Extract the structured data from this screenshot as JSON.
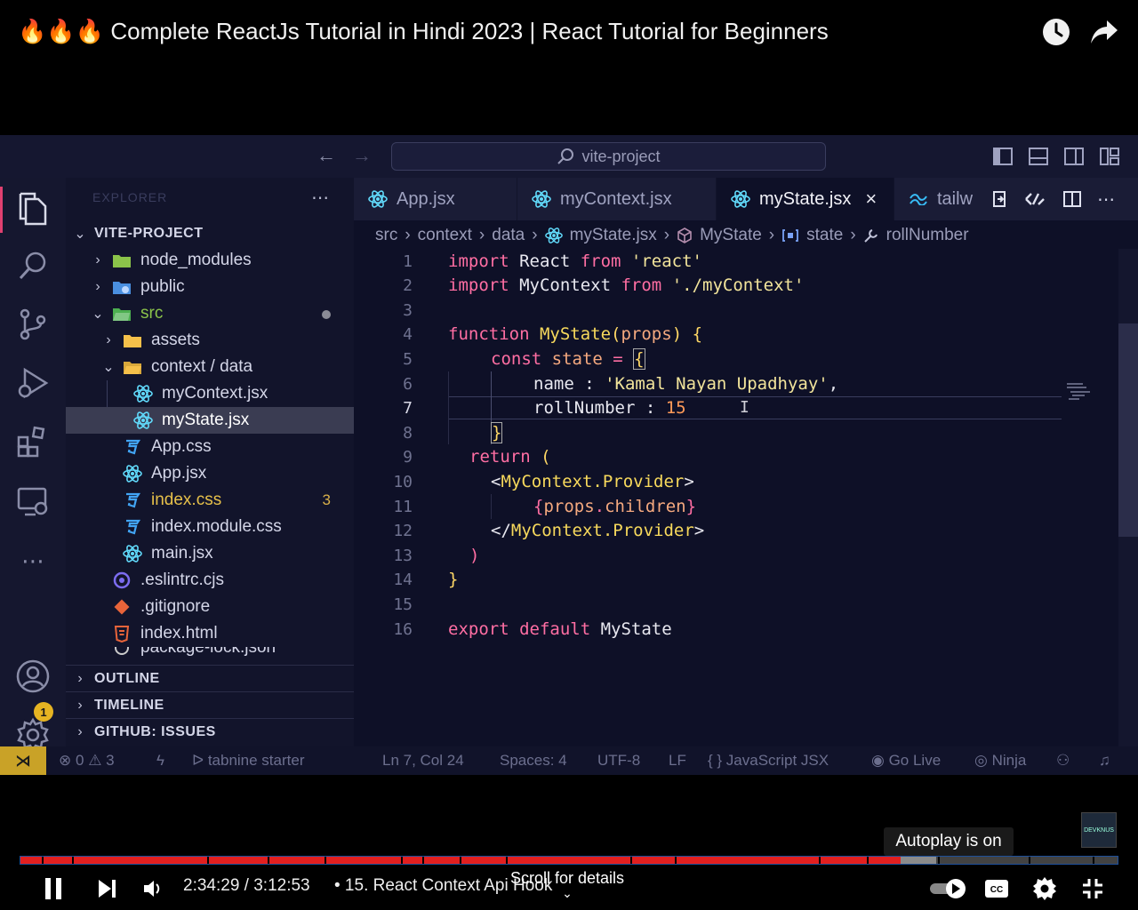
{
  "video": {
    "title": "🔥🔥🔥 Complete ReactJs Tutorial in Hindi 2023 | React Tutorial for Beginners",
    "watch_later_icon": "clock-icon",
    "share_icon": "share-icon"
  },
  "vscode": {
    "search_text": "vite-project",
    "explorer_header": "EXPLORER",
    "sidebar": {
      "project": "VITE-PROJECT",
      "items": [
        {
          "label": "node_modules"
        },
        {
          "label": "public"
        },
        {
          "label": "src"
        },
        {
          "label": "assets"
        },
        {
          "label": "context / data"
        },
        {
          "label": "myContext.jsx"
        },
        {
          "label": "myState.jsx"
        },
        {
          "label": "App.css"
        },
        {
          "label": "App.jsx"
        },
        {
          "label": "index.css",
          "count": "3"
        },
        {
          "label": "index.module.css"
        },
        {
          "label": "main.jsx"
        },
        {
          "label": ".eslintrc.cjs"
        },
        {
          "label": ".gitignore"
        },
        {
          "label": "index.html"
        },
        {
          "label": "package-lock.json"
        }
      ],
      "sections": [
        "OUTLINE",
        "TIMELINE",
        "GITHUB: ISSUES"
      ]
    },
    "account_badge": "1",
    "tabs": [
      {
        "label": "App.jsx"
      },
      {
        "label": "myContext.jsx"
      },
      {
        "label": "myState.jsx",
        "close": "×"
      },
      {
        "label": "tailw"
      }
    ],
    "breadcrumb": [
      "src",
      "context",
      "data",
      "myState.jsx",
      "MyState",
      "state",
      "rollNumber"
    ],
    "line_numbers": [
      "1",
      "2",
      "3",
      "4",
      "5",
      "6",
      "7",
      "8",
      "9",
      "10",
      "11",
      "12",
      "13",
      "14",
      "15",
      "16"
    ],
    "code": {
      "l1_a": "import",
      "l1_b": " React ",
      "l1_c": "from",
      "l1_d": " 'react'",
      "l2_a": "import",
      "l2_b": " MyContext ",
      "l2_c": "from",
      "l2_d": " './myContext'",
      "l4_a": "function",
      "l4_b": " MyState",
      "l4_c": "(",
      "l4_d": "props",
      "l4_e": ") {",
      "l5_a": "const",
      "l5_b": " state",
      "l5_c": " = ",
      "l5_d": "{",
      "l6_a": "name",
      "l6_b": " : ",
      "l6_c": "'Kamal Nayan Upadhyay'",
      "l6_d": ",",
      "l7_a": "rollNumber",
      "l7_b": " : ",
      "l7_c": "15",
      "l8_a": "}",
      "l9_a": "return",
      "l9_b": " (",
      "l10_a": "<",
      "l10_b": "MyContext.Provider",
      "l10_c": ">",
      "l11_a": "{",
      "l11_b": "props",
      "l11_c": ".",
      "l11_d": "children",
      "l11_e": "}",
      "l12_a": "</",
      "l12_b": "MyContext.Provider",
      "l12_c": ">",
      "l13_a": ")",
      "l14_a": "}",
      "l16_a": "export",
      "l16_b": " default",
      "l16_c": " MyState"
    },
    "status": {
      "errors": "0",
      "warnings": "3",
      "tabnine": "tabnine starter",
      "position": "Ln 7, Col 24",
      "spaces": "Spaces: 4",
      "encoding": "UTF-8",
      "eol": "LF",
      "language": "{ } JavaScript JSX",
      "golive": "Go Live",
      "ninja": "Ninja"
    }
  },
  "player": {
    "autoplay_tip": "Autoplay is on",
    "channel_logo": "DEVKNUS",
    "time": "2:34:29 / 3:12:53",
    "chapter": "• 15. React Context Api Hook",
    "scroll_hint": "Scroll for details",
    "progress_fraction": 0.8025,
    "buffer_fraction": 0.835
  }
}
